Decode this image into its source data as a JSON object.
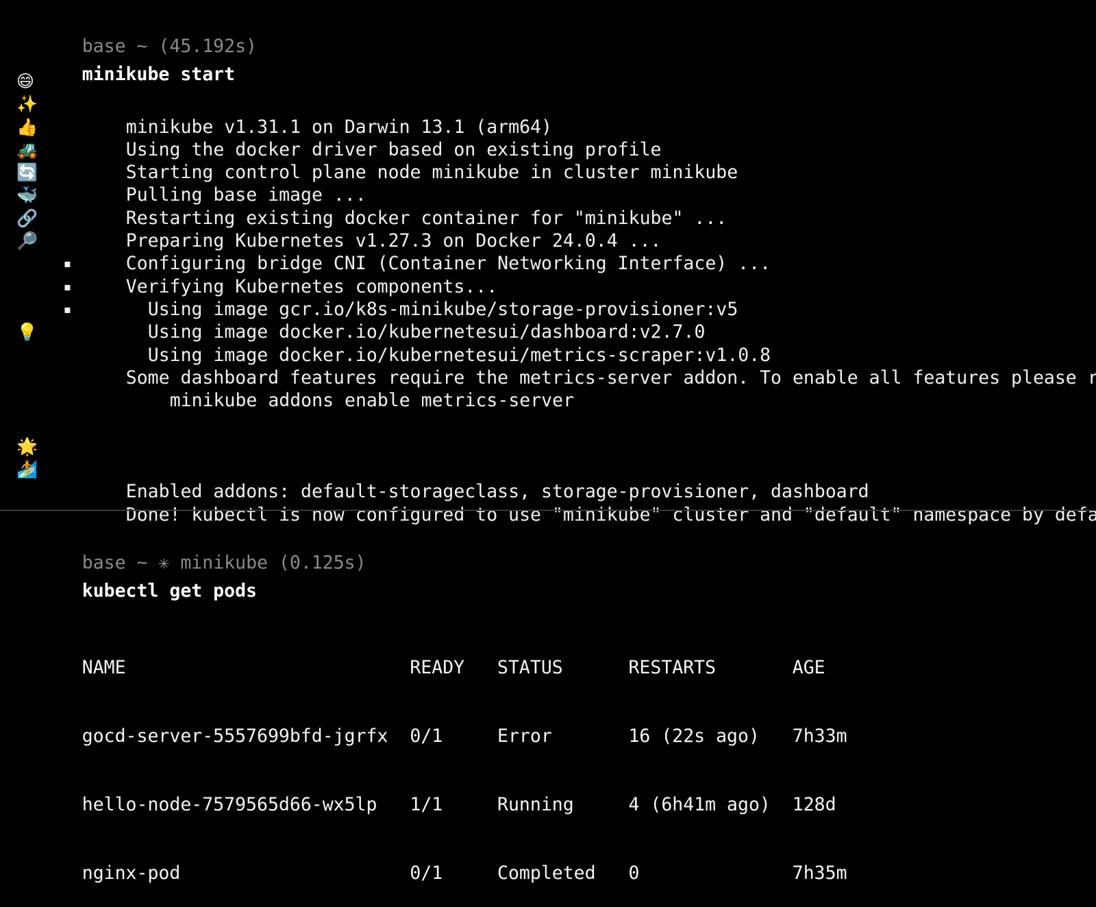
{
  "terminal": {
    "background": "#000000",
    "foreground": "#f0f0f0",
    "prompt_color": "#8a8a8a",
    "divider_color": "#3a3a3a"
  },
  "session_one": {
    "prompt": "base ~ (45.192s)",
    "command": "minikube start",
    "output_lines": [
      {
        "icon": "grinning-face-emoji",
        "glyph": "😄",
        "text": "minikube v1.31.1 on Darwin 13.1 (arm64)"
      },
      {
        "icon": "sparkles-emoji",
        "glyph": "✨",
        "text": "Using the docker driver based on existing profile"
      },
      {
        "icon": "thumbs-up-emoji",
        "glyph": "👍",
        "text": "Starting control plane node minikube in cluster minikube"
      },
      {
        "icon": "tractor-emoji",
        "glyph": "🚜",
        "text": "Pulling base image ..."
      },
      {
        "icon": "counterclockwise-arrows-emoji",
        "glyph": "🔄",
        "text": "Restarting existing docker container for \"minikube\" ..."
      },
      {
        "icon": "whale-emoji",
        "glyph": "🐳",
        "text": "Preparing Kubernetes v1.27.3 on Docker 24.0.4 ..."
      },
      {
        "icon": "link-emoji",
        "glyph": "🔗",
        "text": "Configuring bridge CNI (Container Networking Interface) ..."
      },
      {
        "icon": "magnifying-glass-emoji",
        "glyph": "🔎",
        "text": "Verifying Kubernetes components..."
      }
    ],
    "bullet_lines": [
      {
        "bullet": "▪",
        "text": "Using image gcr.io/k8s-minikube/storage-provisioner:v5"
      },
      {
        "bullet": "▪",
        "text": "Using image docker.io/kubernetesui/dashboard:v2.7.0"
      },
      {
        "bullet": "▪",
        "text": "Using image docker.io/kubernetesui/metrics-scraper:v1.0.8"
      }
    ],
    "hint_line": {
      "icon": "light-bulb-emoji",
      "glyph": "💡",
      "text": "Some dashboard features require the metrics-server addon. To enable all features please run:"
    },
    "hint_command": "minikube addons enable metrics-server",
    "final_lines": [
      {
        "icon": "glowing-star-emoji",
        "glyph": "🌟",
        "text": "Enabled addons: default-storageclass, storage-provisioner, dashboard"
      },
      {
        "icon": "surfer-emoji",
        "glyph": "🏄",
        "text": "Done! kubectl is now configured to use \"minikube\" cluster and \"default\" namespace by default"
      }
    ]
  },
  "session_two": {
    "prompt_prefix": "base ~ ",
    "prompt_glyph": "✳",
    "prompt_suffix": " minikube (0.125s)",
    "command": "kubectl get pods",
    "table": {
      "headers": [
        "NAME",
        "READY",
        "STATUS",
        "RESTARTS",
        "AGE"
      ],
      "col_chars": [
        0,
        30,
        38,
        50,
        65
      ],
      "rows": [
        [
          "gocd-server-5557699bfd-jgrfx",
          "0/1",
          "Error",
          "16 (22s ago)",
          "7h33m"
        ],
        [
          "hello-node-7579565d66-wx5lp",
          "1/1",
          "Running",
          "4 (6h41m ago)",
          "128d"
        ],
        [
          "nginx-pod",
          "0/1",
          "Completed",
          "0",
          "7h35m"
        ]
      ]
    }
  }
}
